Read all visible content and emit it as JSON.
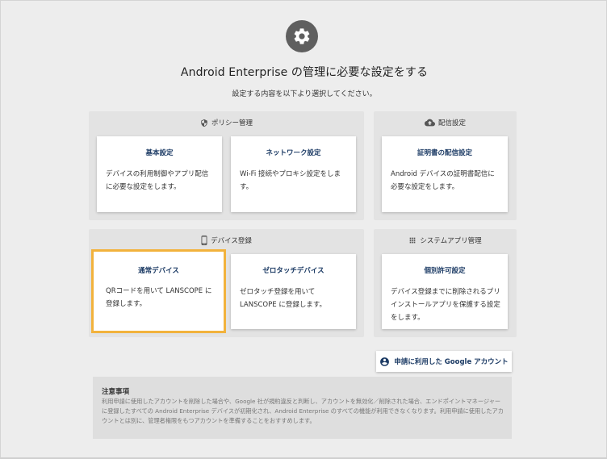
{
  "header": {
    "title": "Android Enterprise の管理に必要な設定をする",
    "subtitle": "設定する内容を以下より選択してください。"
  },
  "groups": {
    "policy": {
      "label": "ポリシー管理",
      "cards": [
        {
          "title": "基本設定",
          "desc": "デバイスの利用制御やアプリ配信に必要な設定をします。"
        },
        {
          "title": "ネットワーク設定",
          "desc": "Wi-Fi 接続やプロキシ設定をします。"
        }
      ]
    },
    "distribution": {
      "label": "配信設定",
      "cards": [
        {
          "title": "証明書の配信設定",
          "desc": "Android デバイスの証明書配信に必要な設定をします。"
        }
      ]
    },
    "device": {
      "label": "デバイス登録",
      "cards": [
        {
          "title": "通常デバイス",
          "desc": "QRコードを用いて LANSCOPE に登録します。"
        },
        {
          "title": "ゼロタッチデバイス",
          "desc": "ゼロタッチ登録を用いて LANSCOPE に登録します。"
        }
      ]
    },
    "system_apps": {
      "label": "システムアプリ管理",
      "cards": [
        {
          "title": "個別許可設定",
          "desc": "デバイス登録までに削除されるプリインストールアプリを保護する設定をします。"
        }
      ]
    }
  },
  "account_button": {
    "label": "申請に利用した Google アカウント"
  },
  "notice": {
    "title": "注意事項",
    "body": "利用申請に使用したアカウントを削除した場合や、Google 社が規約違反と判断し、アカウントを無効化／削除された場合、エンドポイントマネージャーに登録したすべての Android Enterprise デバイスが初期化され、Android Enterprise のすべての機能が利用できなくなります。利用申請に使用したアカウントとは別に、管理者権限をもつアカウントを準備することをおすすめします。"
  },
  "selected_card": "通常デバイス",
  "colors": {
    "accent_title": "#1b3a64",
    "selected_outline": "#f2b23c",
    "gear_bg": "#5f5f5f",
    "background": "#ededed"
  },
  "icons": {
    "header": "gear-icon",
    "policy": "shield-icon",
    "distribution": "cloud-upload-icon",
    "device": "smartphone-icon",
    "system_apps": "grid-icon",
    "account": "account-circle-icon"
  }
}
